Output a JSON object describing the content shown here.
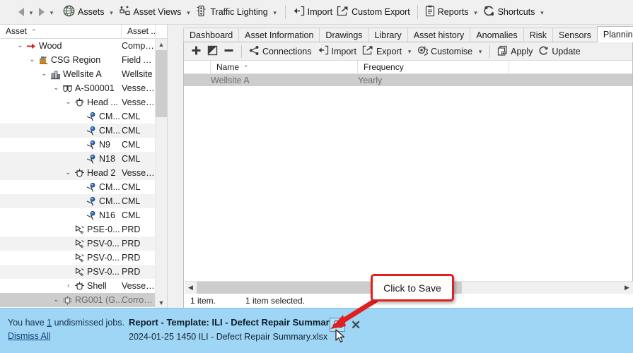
{
  "toolbar": {
    "nav": {
      "back": "back-arrow",
      "back_menu": "back-dropdown",
      "forward": "forward-arrow",
      "forward_menu": "forward-dropdown"
    },
    "items": [
      {
        "label": "Assets",
        "icon": "globe-icon",
        "caret": true
      },
      {
        "label": "Asset Views",
        "icon": "asset-views-icon",
        "caret": true
      },
      {
        "label": "Traffic Lighting",
        "icon": "traffic-light-icon",
        "caret": true
      },
      {
        "label": "Import",
        "icon": "import-icon",
        "caret": false
      },
      {
        "label": "Custom Export",
        "icon": "export-icon",
        "caret": false
      },
      {
        "label": "Reports",
        "icon": "report-clipboard-icon",
        "caret": true
      },
      {
        "label": "Shortcuts",
        "icon": "shortcuts-icon",
        "caret": true
      }
    ]
  },
  "tree": {
    "columns": [
      {
        "label": "Asset",
        "sort": "⌃"
      },
      {
        "label": "Asset ..."
      }
    ],
    "rows": [
      {
        "label": "Wood",
        "type": "Compa...",
        "indent": 1,
        "twist": "⌄",
        "icon": "red-arrow-icon",
        "alt": false,
        "selected": false
      },
      {
        "label": "CSG Region",
        "type": "Field Ar...",
        "indent": 2,
        "twist": "⌄",
        "icon": "field-area-icon",
        "alt": false,
        "selected": false
      },
      {
        "label": "Wellsite A",
        "type": "Wellsite",
        "indent": 3,
        "twist": "⌄",
        "icon": "wellsite-icon",
        "alt": false,
        "selected": false
      },
      {
        "label": "A-S00001",
        "type": "Vessel E...",
        "indent": 4,
        "twist": "⌄",
        "icon": "vessel-equip-icon",
        "alt": false,
        "selected": false
      },
      {
        "label": "Head ...",
        "type": "Vessel C...",
        "indent": 5,
        "twist": "⌄",
        "icon": "vessel-comp-icon",
        "alt": false,
        "selected": false
      },
      {
        "label": "CM...",
        "type": "CML",
        "indent": 6,
        "twist": "",
        "icon": "cml-icon",
        "alt": false,
        "selected": false
      },
      {
        "label": "CM...",
        "type": "CML",
        "indent": 6,
        "twist": "",
        "icon": "cml-icon",
        "alt": true,
        "selected": false
      },
      {
        "label": "N9",
        "type": "CML",
        "indent": 6,
        "twist": "",
        "icon": "cml-icon",
        "alt": false,
        "selected": false
      },
      {
        "label": "N18",
        "type": "CML",
        "indent": 6,
        "twist": "",
        "icon": "cml-icon",
        "alt": true,
        "selected": false
      },
      {
        "label": "Head 2",
        "type": "Vessel C...",
        "indent": 5,
        "twist": "⌄",
        "icon": "vessel-comp-icon",
        "alt": true,
        "selected": false
      },
      {
        "label": "CM...",
        "type": "CML",
        "indent": 6,
        "twist": "",
        "icon": "cml-icon",
        "alt": false,
        "selected": false
      },
      {
        "label": "CM...",
        "type": "CML",
        "indent": 6,
        "twist": "",
        "icon": "cml-icon",
        "alt": true,
        "selected": false
      },
      {
        "label": "N16",
        "type": "CML",
        "indent": 6,
        "twist": "",
        "icon": "cml-icon",
        "alt": false,
        "selected": false
      },
      {
        "label": "PSE-0...",
        "type": "PRD",
        "indent": 5,
        "twist": "",
        "icon": "prd-icon",
        "alt": false,
        "selected": false
      },
      {
        "label": "PSV-0...",
        "type": "PRD",
        "indent": 5,
        "twist": "",
        "icon": "prd-icon",
        "alt": true,
        "selected": false
      },
      {
        "label": "PSV-0...",
        "type": "PRD",
        "indent": 5,
        "twist": "",
        "icon": "prd-icon",
        "alt": false,
        "selected": false
      },
      {
        "label": "PSV-0...",
        "type": "PRD",
        "indent": 5,
        "twist": "",
        "icon": "prd-icon",
        "alt": true,
        "selected": false
      },
      {
        "label": "Shell",
        "type": "Vessel C...",
        "indent": 5,
        "twist": "›",
        "icon": "vessel-comp-icon",
        "alt": false,
        "selected": false
      },
      {
        "label": "RG001 (G...",
        "type": "Corrosi...",
        "indent": 4,
        "twist": "⌄",
        "icon": "corrosion-group-icon",
        "alt": false,
        "selected": true
      }
    ]
  },
  "tabs": {
    "items": [
      "Dashboard",
      "Asset Information",
      "Drawings",
      "Library",
      "Asset history",
      "Anomalies",
      "Risk",
      "Sensors",
      "Planning"
    ],
    "active": "Planning",
    "scroll_prev": "◄",
    "scroll_next": "►"
  },
  "panel_toolbar": {
    "add": {
      "label": "",
      "icon": "plus-icon"
    },
    "edit": {
      "label": "",
      "icon": "edit-pencil-icon"
    },
    "remove": {
      "label": "",
      "icon": "minus-icon"
    },
    "items": [
      {
        "label": "Connections",
        "icon": "connections-icon",
        "caret": false
      },
      {
        "label": "Import",
        "icon": "import-icon",
        "caret": false
      },
      {
        "label": "Export",
        "icon": "export-icon",
        "caret": true
      },
      {
        "label": "Customise",
        "icon": "gear-icon",
        "caret": true
      },
      {
        "label": "Apply",
        "icon": "apply-copy-icon",
        "caret": false
      },
      {
        "label": "Update",
        "icon": "refresh-icon",
        "caret": false
      }
    ]
  },
  "grid": {
    "columns": [
      "Name",
      "Frequency"
    ],
    "sort_indicator": "⌃",
    "rows": [
      {
        "name": "Wellsite A",
        "frequency": "Yearly",
        "selected": true
      }
    ]
  },
  "status": {
    "count": "1 item.",
    "selection": "1 item selected."
  },
  "callout": {
    "text": "Click to Save",
    "color": "#e02020"
  },
  "notification": {
    "undismissed_prefix": "You have ",
    "undismissed_count": "1",
    "undismissed_suffix": " undismissed jobs.",
    "dismiss_all": "Dismiss All",
    "title": "Report - Template: ILI - Defect Repair Summary",
    "subtitle": "2024-01-25 1450 ILI - Defect Repair Summary.xlsx",
    "save_icon": "save-disk-icon",
    "close_icon": "close-x-icon",
    "background": "#9fd6f5"
  }
}
